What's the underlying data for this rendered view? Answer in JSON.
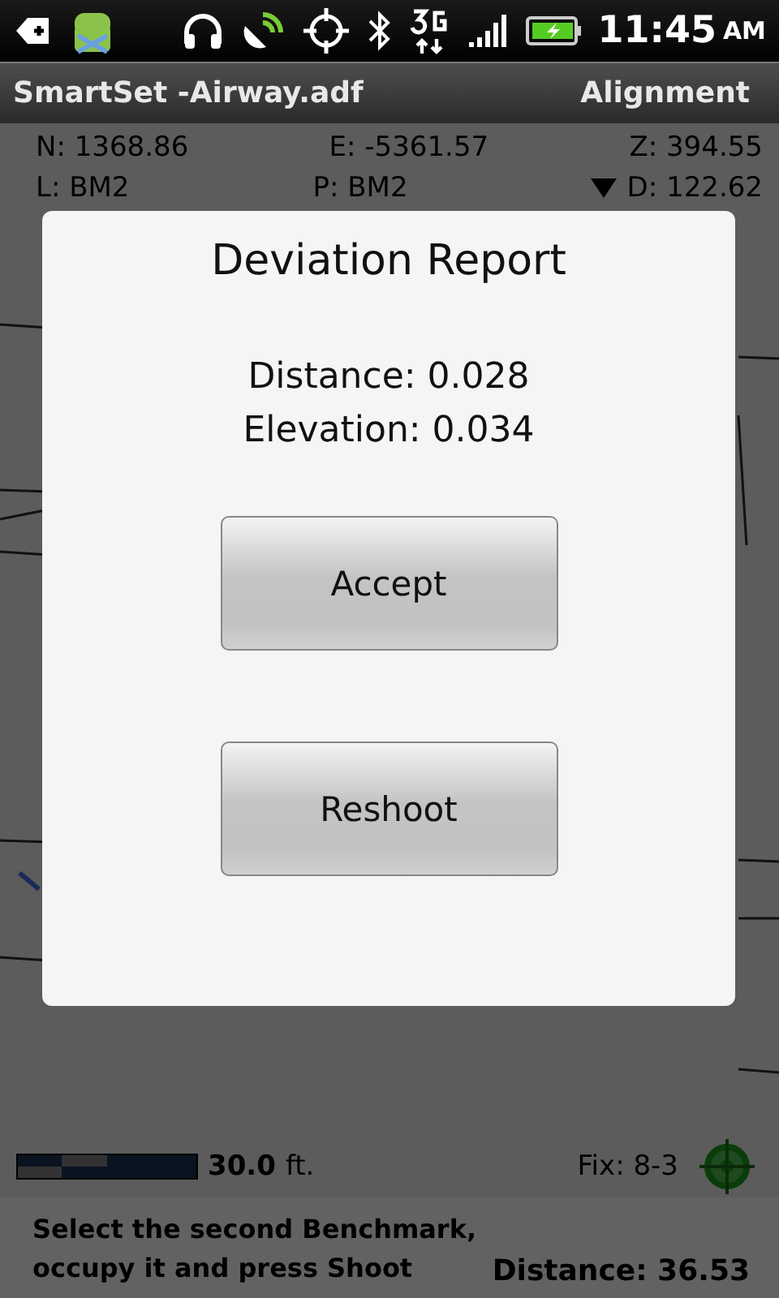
{
  "status_bar": {
    "time": "11:45",
    "meridiem": "AM"
  },
  "title_bar": {
    "title": "SmartSet -Airway.adf",
    "mode": "Alignment"
  },
  "coordinate_rows": [
    [
      "N: 1368.86",
      "E: -5361.57",
      "Z: 394.55"
    ],
    [
      "L: BM2",
      "P: BM2",
      "D: 122.62"
    ]
  ],
  "dialog": {
    "title": "Deviation Report",
    "lines": [
      "Distance: 0.028",
      "Elevation: 0.034"
    ],
    "buttons": [
      "Accept",
      "Reshoot"
    ]
  },
  "scale": {
    "value": "30.0",
    "unit": "ft."
  },
  "fix": "Fix: 8-3",
  "instruction": "Select the second Benchmark, occupy it and press Shoot",
  "distance": "Distance: 36.53"
}
